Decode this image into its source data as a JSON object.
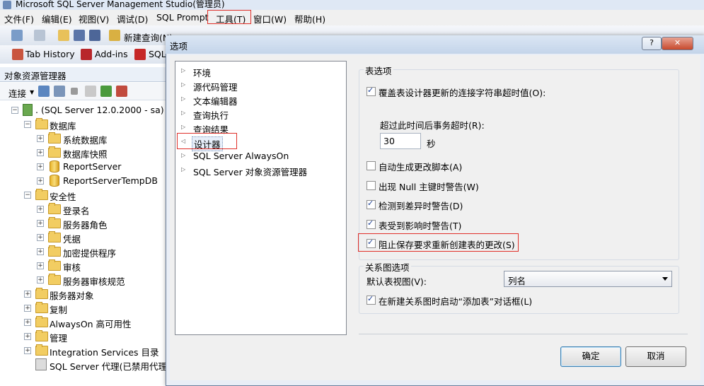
{
  "window": {
    "title": "Microsoft SQL Server Management Studio(管理员)"
  },
  "menu": [
    "文件(F)",
    "编辑(E)",
    "视图(V)",
    "调试(D)",
    "SQL Prompt",
    "工具(T)",
    "窗口(W)",
    "帮助(H)"
  ],
  "toolbar": {
    "new_query": "新建查询(N)",
    "tab_history": "Tab History",
    "addins": "Add-ins",
    "sql": "SQL"
  },
  "object_explorer": {
    "title": "对象资源管理器",
    "connect": "连接",
    "tree": [
      {
        "label": ". (SQL Server 12.0.2000 - sa)",
        "exp": "−"
      },
      {
        "label": "数据库",
        "exp": "−"
      },
      {
        "label": "系统数据库",
        "exp": "+"
      },
      {
        "label": "数据库快照",
        "exp": "+"
      },
      {
        "label": "ReportServer",
        "exp": "+"
      },
      {
        "label": "ReportServerTempDB",
        "exp": "+"
      },
      {
        "label": "安全性",
        "exp": "−"
      },
      {
        "label": "登录名",
        "exp": "+"
      },
      {
        "label": "服务器角色",
        "exp": "+"
      },
      {
        "label": "凭据",
        "exp": "+"
      },
      {
        "label": "加密提供程序",
        "exp": "+"
      },
      {
        "label": "审核",
        "exp": "+"
      },
      {
        "label": "服务器审核规范",
        "exp": "+"
      },
      {
        "label": "服务器对象",
        "exp": "+"
      },
      {
        "label": "复制",
        "exp": "+"
      },
      {
        "label": "AlwaysOn 高可用性",
        "exp": "+"
      },
      {
        "label": "管理",
        "exp": "+"
      },
      {
        "label": "Integration Services 目录",
        "exp": "+"
      },
      {
        "label": "SQL Server 代理(已禁用代理 XP)",
        "exp": ""
      }
    ]
  },
  "dialog": {
    "title": "选项",
    "help": "?",
    "close": "✕",
    "nav": [
      {
        "label": "环境",
        "arrow": "▷"
      },
      {
        "label": "源代码管理",
        "arrow": "▷"
      },
      {
        "label": "文本编辑器",
        "arrow": "▷"
      },
      {
        "label": "查询执行",
        "arrow": "▷"
      },
      {
        "label": "查询结果",
        "arrow": "▷"
      },
      {
        "label": "设计器",
        "arrow": "◁"
      },
      {
        "label": "SQL Server AlwaysOn",
        "arrow": "▷"
      },
      {
        "label": "SQL Server 对象资源管理器",
        "arrow": "▷"
      }
    ],
    "table_options": {
      "title": "表选项",
      "override_timeout": {
        "label": "覆盖表设计器更新的连接字符串超时值(O):",
        "checked": true
      },
      "timeout_label": "超过此时间后事务超时(R):",
      "timeout_value": "30",
      "timeout_unit": "秒",
      "auto_script": {
        "label": "自动生成更改脚本(A)",
        "checked": false
      },
      "null_pk_warn": {
        "label": "出现 Null 主键时警告(W)",
        "checked": false
      },
      "diff_warn": {
        "label": "检测到差异时警告(D)",
        "checked": true
      },
      "affected_warn": {
        "label": "表受到影响时警告(T)",
        "checked": true
      },
      "prevent_recreate": {
        "label": "阻止保存要求重新创建表的更改(S)",
        "checked": true
      }
    },
    "diagram_options": {
      "title": "关系图选项",
      "default_view_label": "默认表视图(V):",
      "default_view_value": "列名",
      "launch_add_table": {
        "label": "在新建关系图时启动“添加表”对话框(L)",
        "checked": true
      }
    },
    "ok": "确定",
    "cancel": "取消"
  }
}
